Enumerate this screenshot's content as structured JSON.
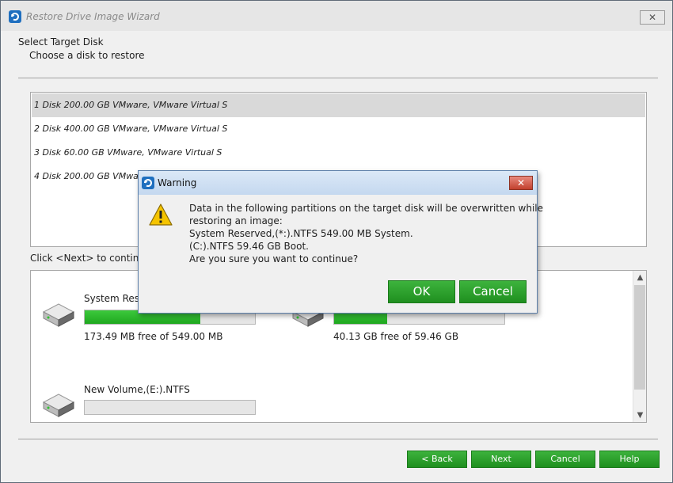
{
  "window": {
    "title": "Restore Drive Image Wizard",
    "close_glyph": "✕"
  },
  "header": {
    "title": "Select Target Disk",
    "subtitle": "Choose a disk to restore"
  },
  "disks": [
    {
      "label": "1 Disk 200.00 GB VMware,  VMware Virtual S",
      "selected": true
    },
    {
      "label": "2 Disk 400.00 GB VMware,  VMware Virtual S",
      "selected": false
    },
    {
      "label": "3 Disk 60.00 GB VMware,  VMware Virtual S",
      "selected": false
    },
    {
      "label": "4 Disk 200.00 GB VMware",
      "selected": false
    }
  ],
  "hint": "Click <Next> to continue",
  "partitions": [
    {
      "name": "System Res",
      "free": "173.49 MB free of 549.00 MB",
      "used_fraction": 0.68
    },
    {
      "name": "",
      "free": "40.13 GB free of 59.46 GB",
      "used_fraction": 0.31
    },
    {
      "name": "New Volume,(E:).NTFS",
      "free": "",
      "used_fraction": 0
    }
  ],
  "scrollbar": {
    "up": "▲",
    "down": "▼"
  },
  "buttons": {
    "back": "< Back",
    "next": "Next",
    "cancel": "Cancel",
    "help": "Help"
  },
  "dialog": {
    "title": "Warning",
    "close_glyph": "✕",
    "lines": [
      "Data in the following partitions on the target disk will be overwritten while",
      "restoring an image:",
      "System Reserved,(*:).NTFS 549.00 MB System.",
      "(C:).NTFS 59.46 GB Boot.",
      "Are you sure you want to continue?"
    ],
    "ok": "OK",
    "cancel": "Cancel"
  },
  "colors": {
    "accent_green": "#2ca62c",
    "selection": "#d9d9d9",
    "warning_close": "#c2402e"
  }
}
